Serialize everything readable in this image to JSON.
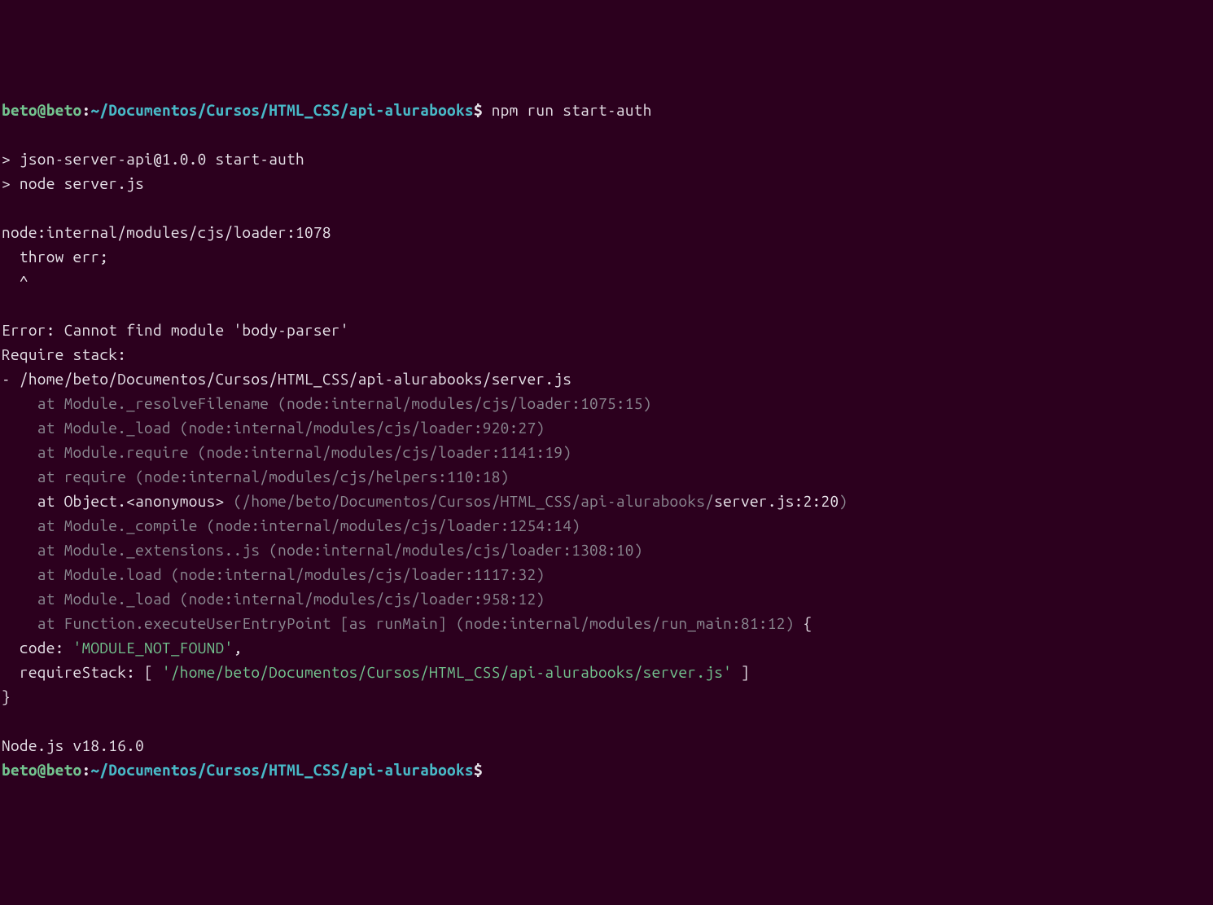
{
  "prompt1": {
    "user": "beto@beto",
    "colon": ":",
    "path": "~/Documentos/Cursos/HTML_CSS/api-alurabooks",
    "dollar": "$",
    "command": " npm run start-auth"
  },
  "blank1": "",
  "script_line1": "> json-server-api@1.0.0 start-auth",
  "script_line2": "> node server.js",
  "blank2": "",
  "loader_line": "node:internal/modules/cjs/loader:1078",
  "throw_line": "  throw err;",
  "caret_line": "  ^",
  "blank3": "",
  "error_line": "Error: Cannot find module 'body-parser'",
  "require_stack_label": "Require stack:",
  "require_stack_file": "- /home/beto/Documentos/Cursos/HTML_CSS/api-alurabooks/server.js",
  "trace1": "    at Module._resolveFilename (node:internal/modules/cjs/loader:1075:15)",
  "trace2": "    at Module._load (node:internal/modules/cjs/loader:920:27)",
  "trace3": "    at Module.require (node:internal/modules/cjs/loader:1141:19)",
  "trace4": "    at require (node:internal/modules/cjs/helpers:110:18)",
  "trace5_part1": "    at Object.<anonymous> ",
  "trace5_part2": "(/home/beto/Documentos/Cursos/HTML_CSS/api-alurabooks/",
  "trace5_part3": "server.js:2:20",
  "trace5_part4": ")",
  "trace6": "    at Module._compile (node:internal/modules/cjs/loader:1254:14)",
  "trace7": "    at Module._extensions..js (node:internal/modules/cjs/loader:1308:10)",
  "trace8": "    at Module.load (node:internal/modules/cjs/loader:1117:32)",
  "trace9": "    at Module._load (node:internal/modules/cjs/loader:958:12)",
  "trace10_part1": "    at Function.executeUserEntryPoint [as runMain] (node:internal/modules/run_main:81:12)",
  "trace10_part2": " {",
  "code_line_part1": "  code: ",
  "code_line_part2": "'MODULE_NOT_FOUND'",
  "code_line_part3": ",",
  "reqstack_part1": "  requireStack: [ ",
  "reqstack_part2": "'/home/beto/Documentos/Cursos/HTML_CSS/api-alurabooks/server.js'",
  "reqstack_part3": " ]",
  "closing_brace": "}",
  "blank4": "",
  "node_version": "Node.js v18.16.0",
  "prompt2": {
    "user": "beto@beto",
    "colon": ":",
    "path": "~/Documentos/Cursos/HTML_CSS/api-alurabooks",
    "dollar": "$"
  }
}
